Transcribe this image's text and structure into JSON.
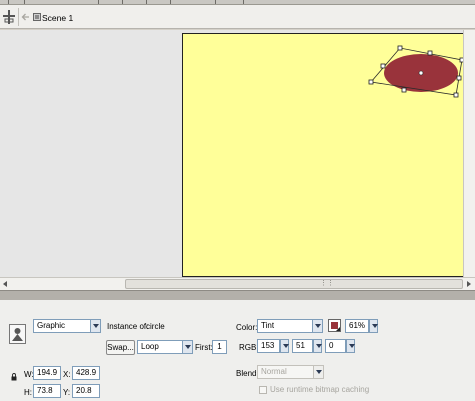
{
  "edit_bar": {
    "scene_label": "Scene 1",
    "icons": [
      "timeline-toggle-icon",
      "back-arrow-icon",
      "scene-icon"
    ]
  },
  "stage": {
    "background_color": "#ffff99",
    "shape_fill_color": "#99333b"
  },
  "properties": {
    "symbol_type": "Graphic",
    "instance_label": "Instance of:",
    "instance_name": "circle",
    "swap_button": "Swap...",
    "loop_mode": "Loop",
    "first_label": "First:",
    "first_value": "1",
    "w_label": "W:",
    "w_value": "194.9",
    "h_label": "H:",
    "h_value": "73.8",
    "x_label": "X:",
    "x_value": "428.9",
    "y_label": "Y:",
    "y_value": "20.8",
    "color_label": "Color:",
    "color_mode": "Tint",
    "tint_swatch_color": "#99333b",
    "tint_amount": "61%",
    "rgb_label": "RGB:",
    "rgb_r": "153",
    "rgb_g": "51",
    "rgb_b": "0",
    "blend_label": "Blend:",
    "blend_mode": "Normal",
    "bitmap_caching_label": "Use runtime bitmap caching"
  }
}
